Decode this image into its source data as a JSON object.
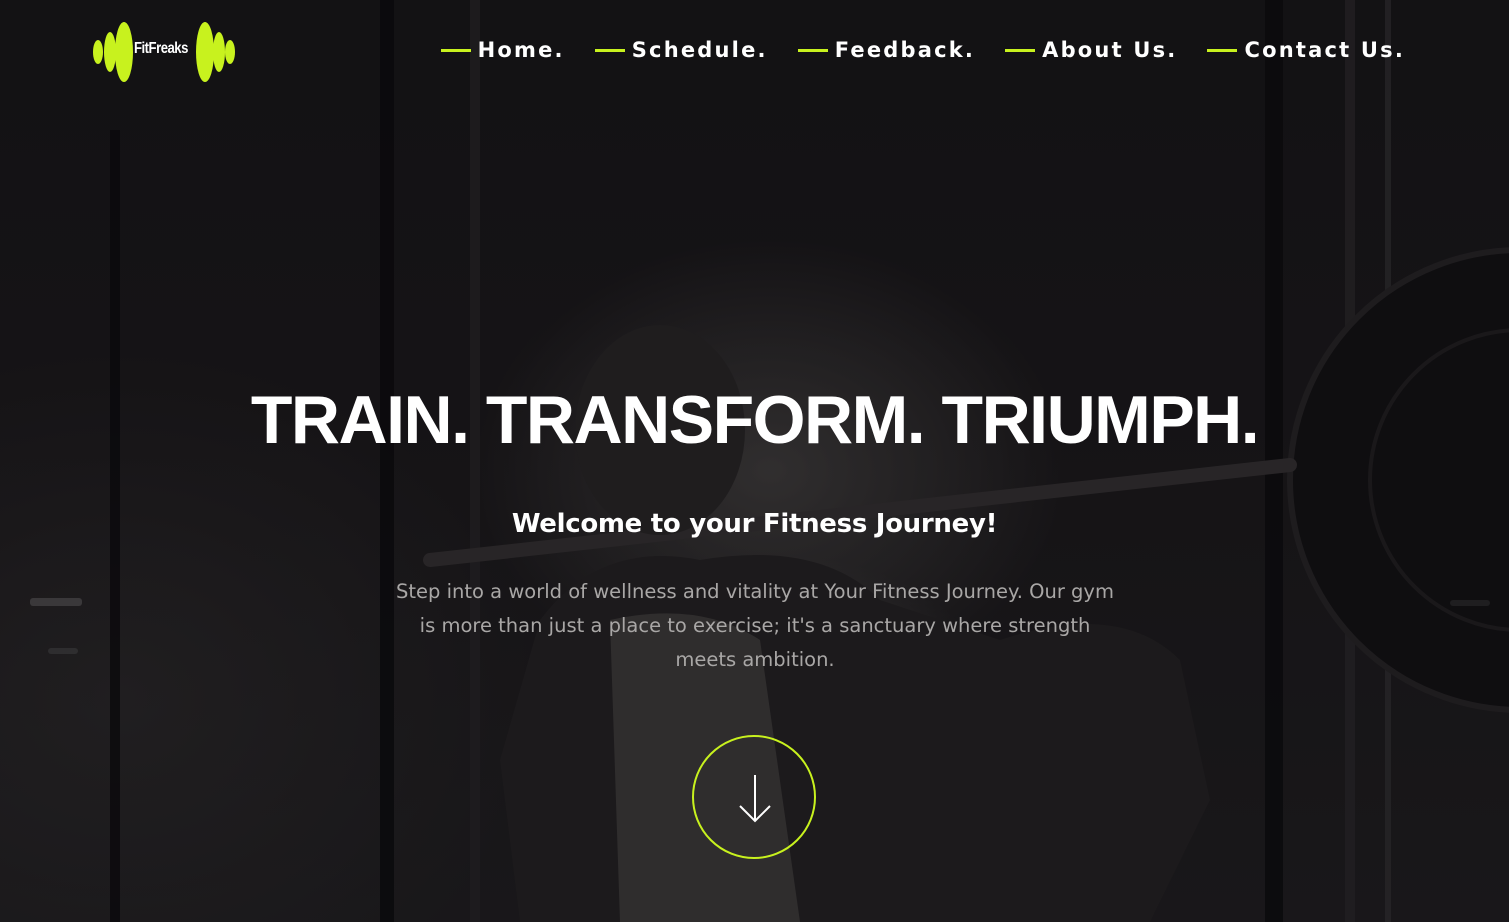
{
  "brand": {
    "logo_text": "FitFreaks",
    "accent_color": "#c8f21e"
  },
  "nav": {
    "items": [
      {
        "label": "Home."
      },
      {
        "label": "Schedule."
      },
      {
        "label": "Feedback."
      },
      {
        "label": "About Us."
      },
      {
        "label": "Contact Us."
      }
    ]
  },
  "hero": {
    "title": "TRAIN. TRANSFORM. TRIUMPH.",
    "subtitle": "Welcome to your Fitness Journey!",
    "text": "Step into a world of wellness and vitality at Your Fitness Journey. Our gym is more than just a place to exercise; it's a sanctuary where strength meets ambition.",
    "scroll_icon": "arrow-down-icon"
  }
}
